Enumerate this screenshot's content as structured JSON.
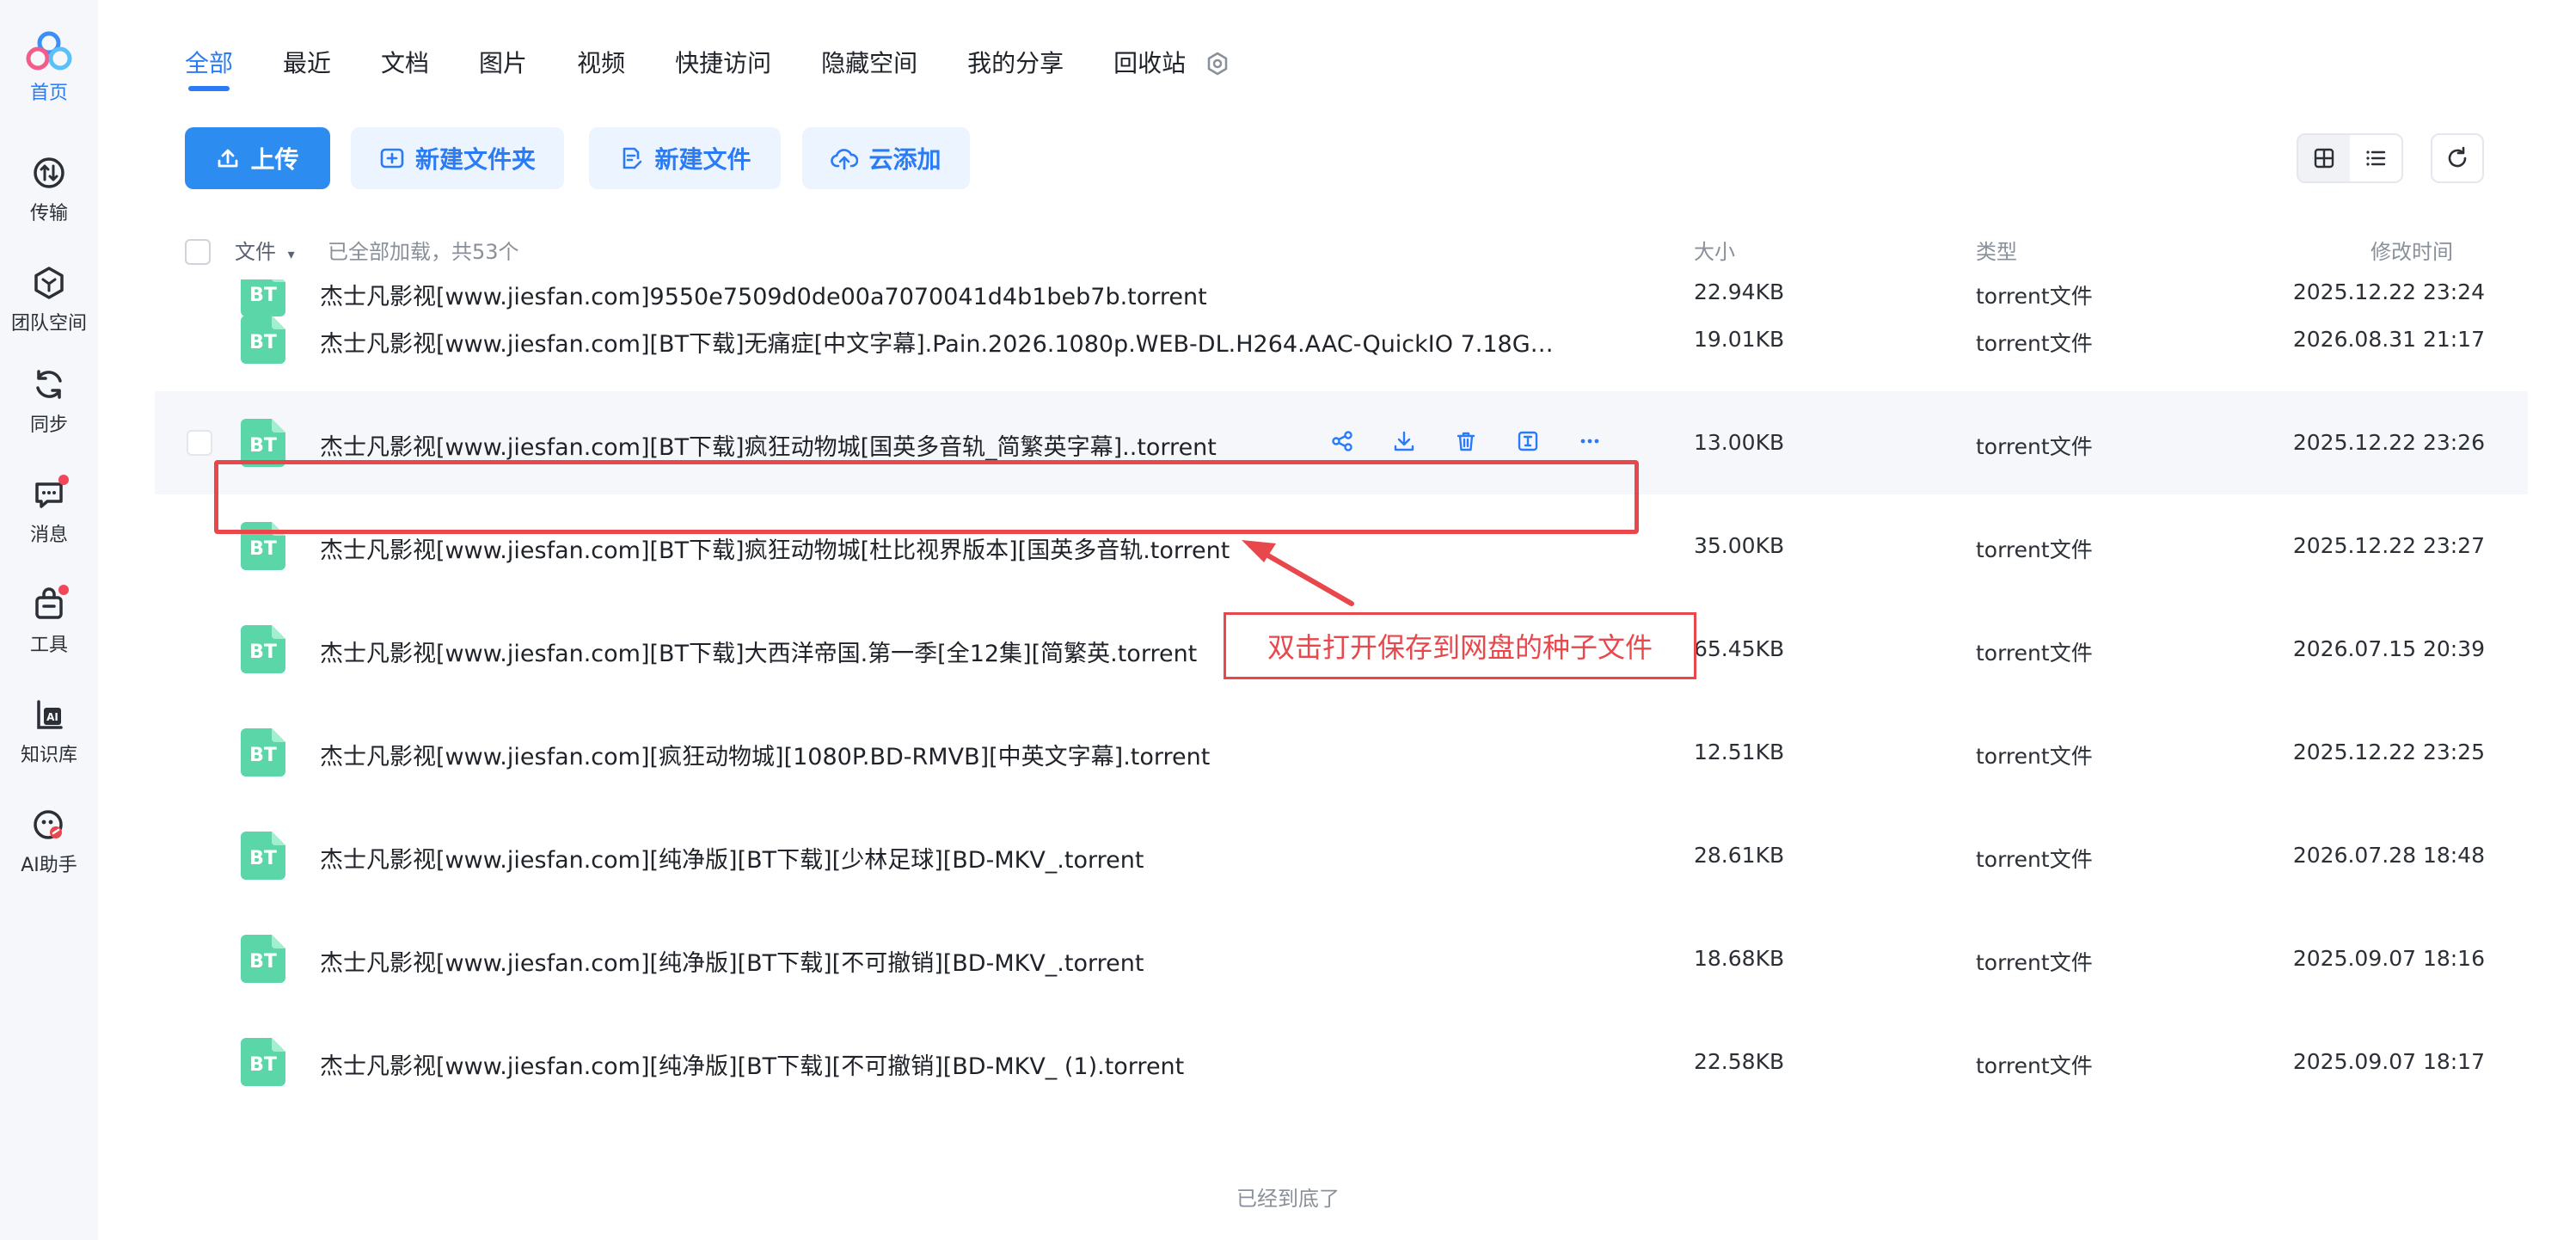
{
  "sidebar": {
    "items": [
      {
        "label": "首页",
        "icon": "cloud-logo-icon",
        "active": true
      },
      {
        "label": "传输",
        "icon": "transfer-icon"
      },
      {
        "label": "团队空间",
        "icon": "team-space-icon"
      },
      {
        "label": "同步",
        "icon": "sync-icon"
      },
      {
        "label": "消息",
        "icon": "message-icon",
        "badge": true
      },
      {
        "label": "工具",
        "icon": "tools-icon",
        "badge": true
      },
      {
        "label": "知识库",
        "icon": "knowledge-base-icon"
      },
      {
        "label": "AI助手",
        "icon": "ai-assistant-icon"
      }
    ]
  },
  "tabs": [
    {
      "label": "全部",
      "active": true
    },
    {
      "label": "最近"
    },
    {
      "label": "文档"
    },
    {
      "label": "图片"
    },
    {
      "label": "视频"
    },
    {
      "label": "快捷访问"
    },
    {
      "label": "隐藏空间"
    },
    {
      "label": "我的分享"
    },
    {
      "label": "回收站"
    }
  ],
  "toolbar": {
    "upload": "上传",
    "new_folder": "新建文件夹",
    "new_file": "新建文件",
    "cloud_add": "云添加"
  },
  "list_header": {
    "file": "文件",
    "loaded_status": "已全部加载，共53个",
    "size": "大小",
    "type": "类型",
    "modified": "修改时间"
  },
  "files": [
    {
      "name": "杰士凡影视[www.jiesfan.com]9550e7509d0de00a7070041d4b1beb7b.torrent",
      "size": "22.94KB",
      "type": "torrent文件",
      "modified": "2025.12.22 23:24"
    },
    {
      "name": "杰士凡影视[www.jiesfan.com][BT下载]无痛症[中文字幕].Pain.2026.1080p.WEB-DL.H264.AAC-QuickIO 7.18G…",
      "size": "19.01KB",
      "type": "torrent文件",
      "modified": "2026.08.31 21:17"
    },
    {
      "name": "杰士凡影视[www.jiesfan.com][BT下载]疯狂动物城[国英多音轨_简繁英字幕]..torrent",
      "size": "13.00KB",
      "type": "torrent文件",
      "modified": "2025.12.22 23:26"
    },
    {
      "name": "杰士凡影视[www.jiesfan.com][BT下载]疯狂动物城[杜比视界版本][国英多音轨.torrent",
      "size": "35.00KB",
      "type": "torrent文件",
      "modified": "2025.12.22 23:27"
    },
    {
      "name": "杰士凡影视[www.jiesfan.com][BT下载]大西洋帝国.第一季[全12集][简繁英.torrent",
      "size": "65.45KB",
      "type": "torrent文件",
      "modified": "2026.07.15 20:39"
    },
    {
      "name": "杰士凡影视[www.jiesfan.com][疯狂动物城][1080P.BD-RMVB][中英文字幕].torrent",
      "size": "12.51KB",
      "type": "torrent文件",
      "modified": "2025.12.22 23:25"
    },
    {
      "name": "杰士凡影视[www.jiesfan.com][纯净版][BT下载][少林足球][BD-MKV_.torrent",
      "size": "28.61KB",
      "type": "torrent文件",
      "modified": "2026.07.28 18:48"
    },
    {
      "name": "杰士凡影视[www.jiesfan.com][纯净版][BT下载][不可撤销][BD-MKV_.torrent",
      "size": "18.68KB",
      "type": "torrent文件",
      "modified": "2025.09.07 18:16"
    },
    {
      "name": "杰士凡影视[www.jiesfan.com][纯净版][BT下载][不可撤销][BD-MKV_ (1).torrent",
      "size": "22.58KB",
      "type": "torrent文件",
      "modified": "2025.09.07 18:17"
    }
  ],
  "file_icon_text": "BT",
  "annotation": "双击打开保存到网盘的种子文件",
  "footer": "已经到底了",
  "colors": {
    "accent": "#2a7cf6",
    "bt_icon": "#5bd6a8",
    "annotation": "#e8474c"
  }
}
